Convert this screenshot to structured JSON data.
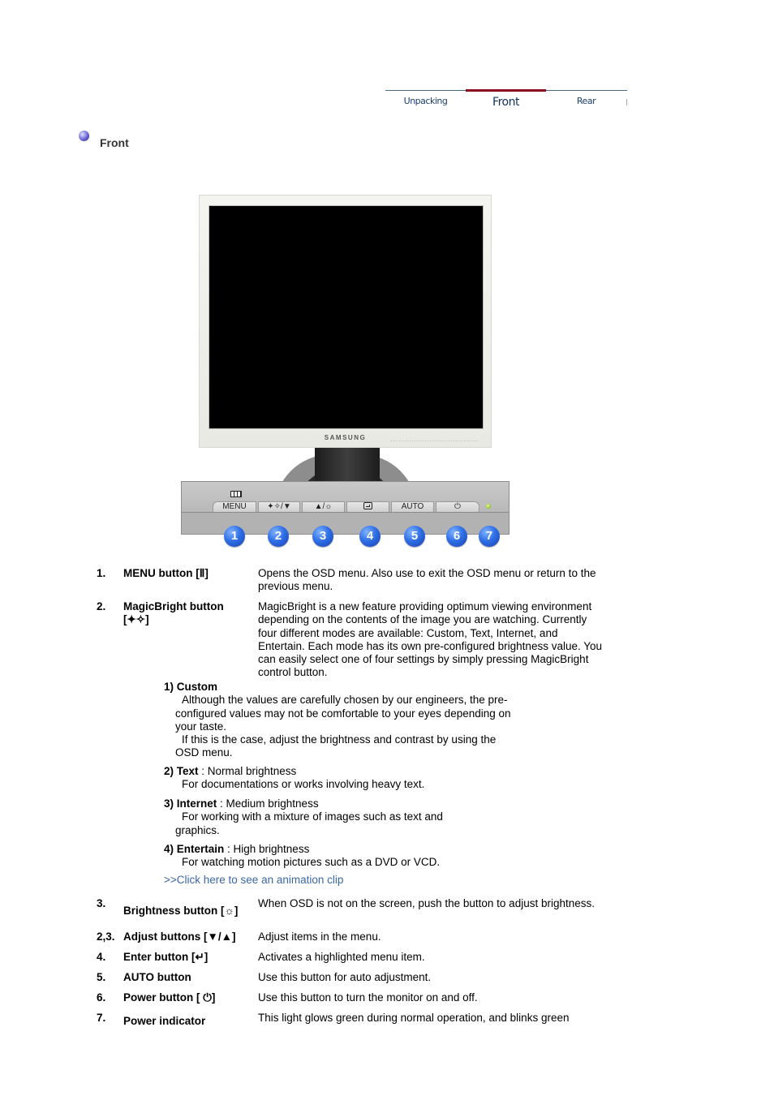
{
  "tabs": [
    {
      "label": "Unpacking",
      "active": false
    },
    {
      "label": "Front",
      "active": true
    },
    {
      "label": "Rear",
      "active": false
    }
  ],
  "colors": {
    "tab_active_bar": "#8e0d1c",
    "tab_text": "#1c3f6e",
    "link": "#3a67a8",
    "callout_blue": "#2f6fe6",
    "power_led": "#8cc21c"
  },
  "section": {
    "title": "Front",
    "bullet_icon": "purple-orb-bullet"
  },
  "monitor": {
    "brand": "SAMSUNG",
    "controls": [
      {
        "label": "MENU",
        "icon": "menu-icon"
      },
      {
        "label": "✦✧/▼",
        "icon": "magicbright-down-icon"
      },
      {
        "label": "▲/☼",
        "icon": "up-brightness-icon"
      },
      {
        "label": "",
        "icon": "enter-icon"
      },
      {
        "label": "AUTO",
        "icon": "auto-icon"
      },
      {
        "label": "⏻",
        "icon": "power-icon"
      }
    ],
    "callouts": [
      "1",
      "2",
      "3",
      "4",
      "5",
      "6",
      "7"
    ]
  },
  "items": [
    {
      "num": "1.",
      "name": "MENU button [Ⅱ]",
      "text": "Opens the OSD menu. Also use to exit the OSD menu or return to the previous menu."
    },
    {
      "num": "2.",
      "name": "MagicBright button [✦✧]",
      "text": "MagicBright is a new feature providing optimum viewing environment depending on the contents of the image you are watching. Currently four different modes are available: Custom, Text, Internet, and Entertain. Each mode has its own pre-configured brightness value. You can easily select one of four settings by simply pressing MagicBright control button."
    },
    {
      "num": "3.",
      "name": "Brightness button [☼]",
      "text": "When OSD is not on the screen, push the button to adjust brightness."
    },
    {
      "num": "2,3.",
      "name": "Adjust buttons [▼/▲]",
      "text": "Adjust items in the menu."
    },
    {
      "num": "4.",
      "name": "Enter button [↵]",
      "text": "Activates a highlighted menu item."
    },
    {
      "num": "5.",
      "name": "AUTO button",
      "text": "Use this button for auto adjustment."
    },
    {
      "num": "6.",
      "name": "Power button [ ⏻]",
      "text": "Use this button to turn the monitor on and off."
    },
    {
      "num": "7.",
      "name": "Power indicator",
      "text": "This light glows green during normal operation, and blinks green"
    }
  ],
  "modes": [
    {
      "title": "1) Custom",
      "suffix": "",
      "lines": [
        "Although the values are carefully chosen by our engineers, the pre-configured values may not be comfortable to your eyes depending on your taste.",
        "If this is the case, adjust the brightness and contrast by using the OSD menu."
      ]
    },
    {
      "title": "2) Text",
      "suffix": " : Normal brightness",
      "lines": [
        "For documentations or works involving heavy text."
      ]
    },
    {
      "title": "3) Internet",
      "suffix": " : Medium brightness",
      "lines": [
        "For working with a mixture of images such as text and graphics."
      ]
    },
    {
      "title": "4) Entertain",
      "suffix": " : High brightness",
      "lines": [
        "For watching motion pictures such as a DVD or VCD."
      ]
    }
  ],
  "animation_link": ">>Click here to see an animation clip"
}
